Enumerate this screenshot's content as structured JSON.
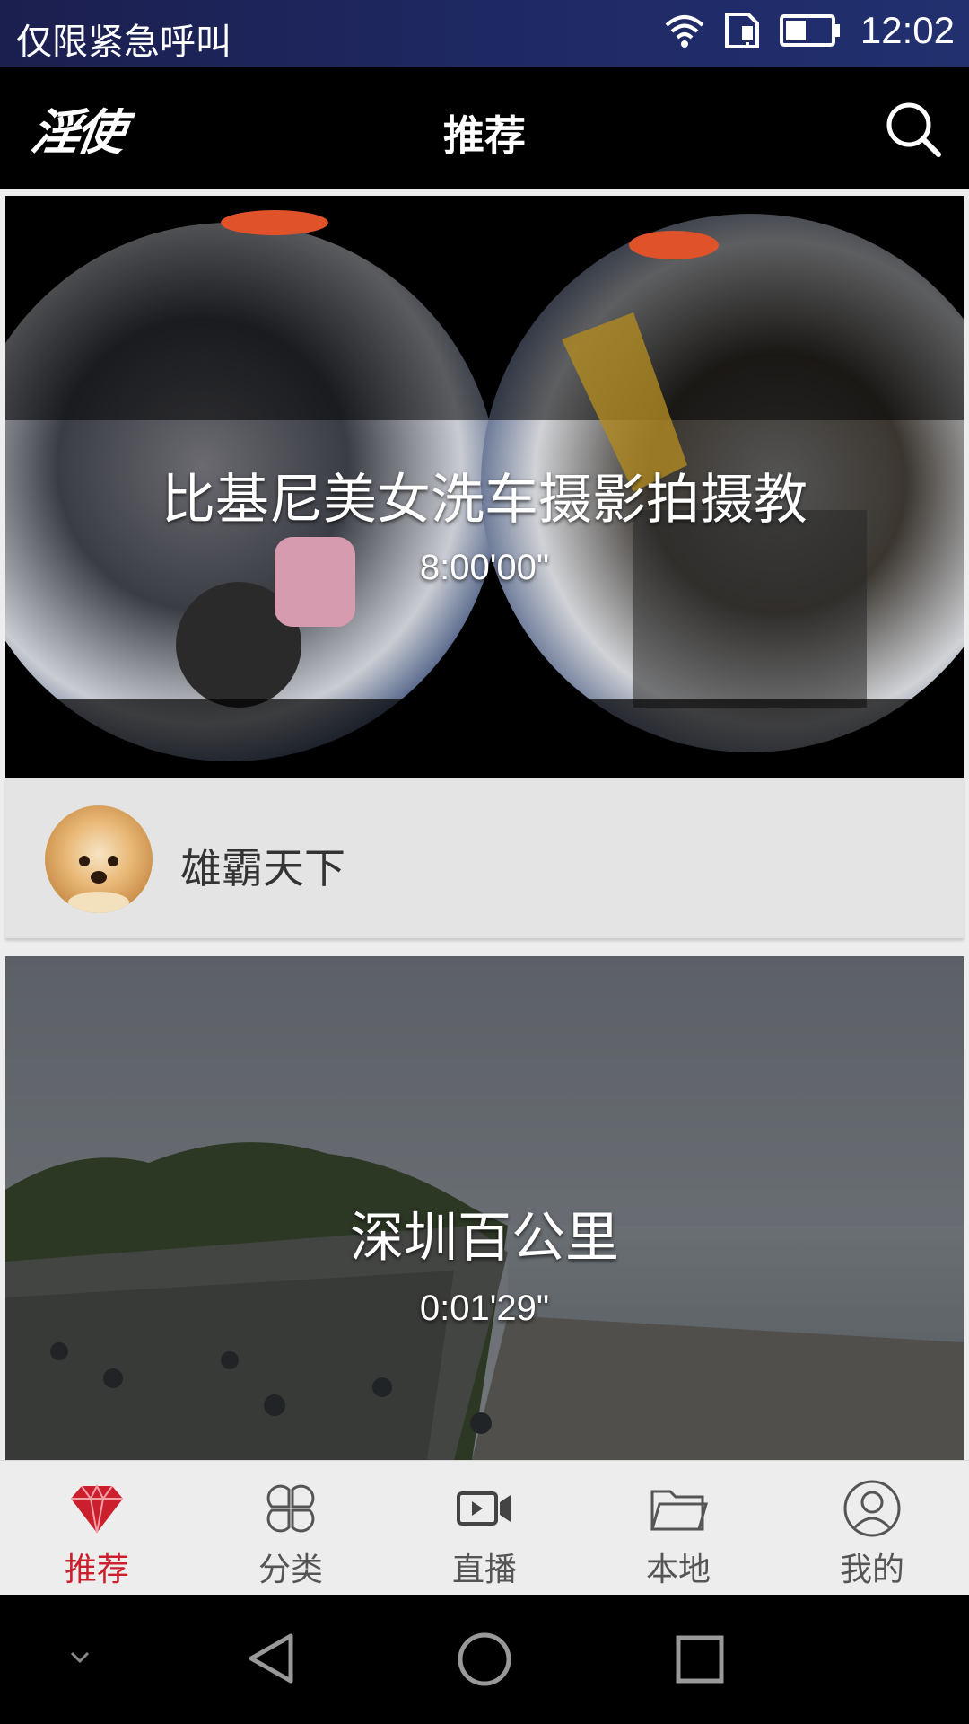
{
  "status_bar": {
    "carrier_text": "仅限紧急呼叫",
    "time": "12:02"
  },
  "header": {
    "logo": "淫使",
    "title": "推荐"
  },
  "feed": [
    {
      "title": "比基尼美女洗车摄影拍摄教",
      "duration": "8:00'00\"",
      "author": "雄霸天下"
    },
    {
      "title": "深圳百公里",
      "duration": "0:01'29\""
    }
  ],
  "bottom_nav": {
    "items": [
      {
        "label": "推荐",
        "icon": "diamond-icon",
        "active": true
      },
      {
        "label": "分类",
        "icon": "grid-icon",
        "active": false
      },
      {
        "label": "直播",
        "icon": "video-camera-icon",
        "active": false
      },
      {
        "label": "本地",
        "icon": "folder-icon",
        "active": false
      },
      {
        "label": "我的",
        "icon": "user-icon",
        "active": false
      }
    ],
    "active_color": "#cc1f2e",
    "inactive_color": "#555555"
  }
}
